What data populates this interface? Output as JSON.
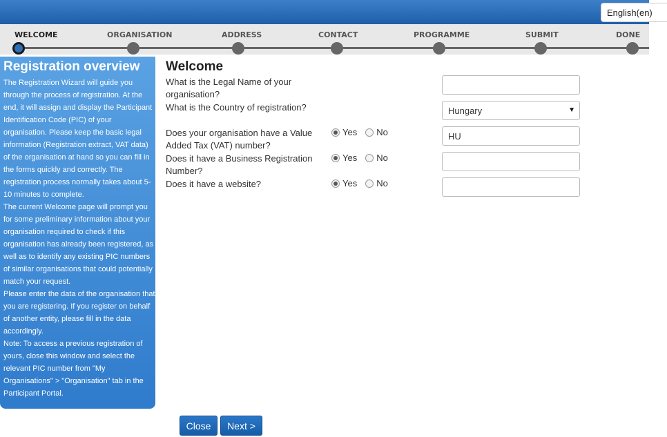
{
  "language": "English(en)",
  "steps": [
    {
      "label": "WELCOME"
    },
    {
      "label": "ORGANISATION"
    },
    {
      "label": "ADDRESS"
    },
    {
      "label": "CONTACT"
    },
    {
      "label": "PROGRAMME"
    },
    {
      "label": "SUBMIT"
    },
    {
      "label": "DONE"
    }
  ],
  "active_step": "WELCOME",
  "sidebar": {
    "title": "Registration overview",
    "paragraphs": [
      "The Registration Wizard will guide you through the process of registration. At the end, it will assign and display the Participant Identification Code (PIC) of your organisation. Please keep the basic legal information (Registration extract, VAT data) of the organisation at hand so you can fill in the forms quickly and correctly. The registration process normally takes about 5-10 minutes to complete.",
      "The current Welcome page will prompt you for some preliminary information about your organisation required to check if this organisation has already been registered, as well as to identify any existing PIC numbers of similar organisations that could potentially match your request.",
      "Please enter the data of the organisation that you are registering. If you register on behalf of another entity, please fill in the data accordingly.",
      "Note: To access a previous registration of yours, close this window and select the relevant PIC number from \"My Organisations\" > \"Organisation\" tab in the Participant Portal."
    ]
  },
  "main": {
    "title": "Welcome",
    "questions": {
      "legal_name": {
        "label": "What is the Legal Name of your organisation?",
        "value": ""
      },
      "country": {
        "label": "What is the Country of registration?",
        "value": "Hungary"
      },
      "vat": {
        "label": "Does your organisation have a Value Added Tax (VAT) number?",
        "yes": "Yes",
        "no": "No",
        "selected": "Yes",
        "value": "HU"
      },
      "business_reg": {
        "label": "Does it have a Business Registration Number?",
        "yes": "Yes",
        "no": "No",
        "selected": "Yes",
        "value": ""
      },
      "website": {
        "label": "Does it have a website?",
        "yes": "Yes",
        "no": "No",
        "selected": "Yes",
        "value": ""
      }
    }
  },
  "buttons": {
    "close": "Close",
    "next": "Next >"
  },
  "colors": {
    "accent": "#2d6fb6",
    "sidebar_top": "#5aa2e3",
    "sidebar_bottom": "#2f7bcc"
  }
}
